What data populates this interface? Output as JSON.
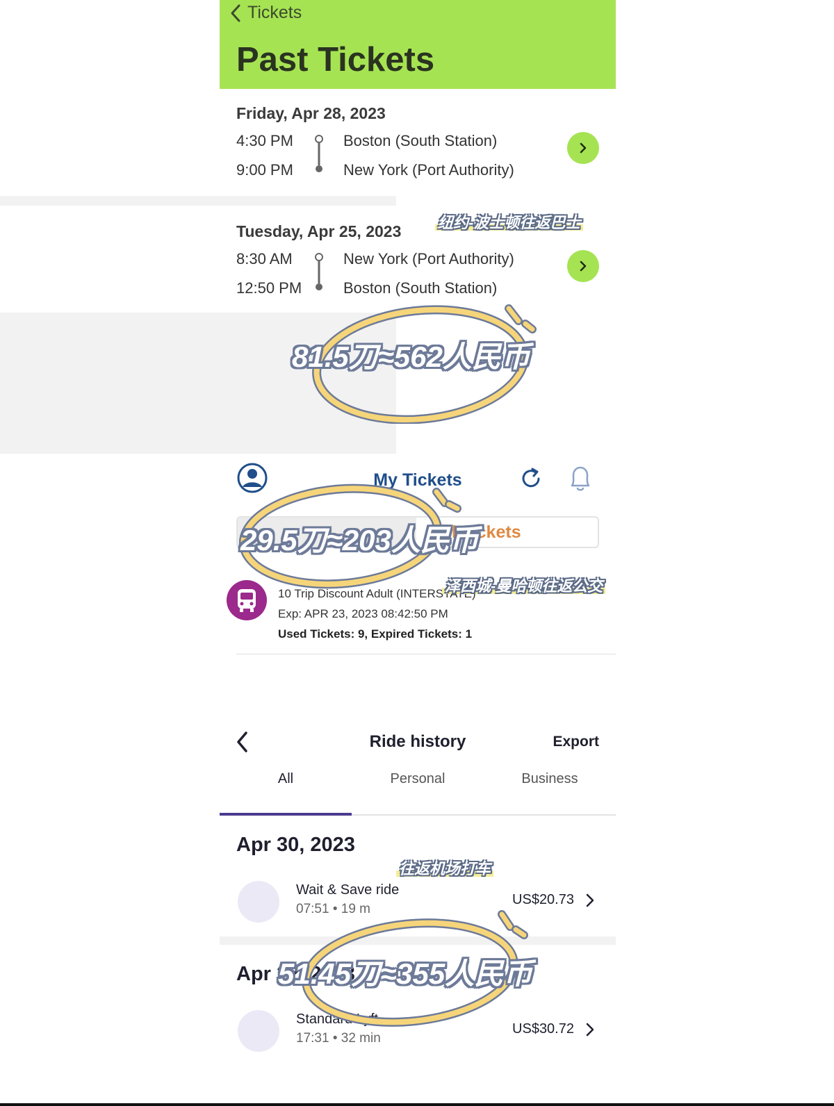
{
  "past_tickets": {
    "back_label": "Tickets",
    "title": "Past Tickets",
    "trips": [
      {
        "date": "Friday, Apr 28, 2023",
        "depart_time": "4:30 PM",
        "arrive_time": "9:00 PM",
        "origin": "Boston (South Station)",
        "destination": "New York (Port Authority)"
      },
      {
        "date": "Tuesday, Apr 25, 2023",
        "depart_time": "8:30 AM",
        "arrive_time": "12:50 PM",
        "origin": "New York (Port Authority)",
        "destination": "Boston (South Station)"
      }
    ]
  },
  "my_tickets": {
    "title": "My Tickets",
    "tab_all": "All Tickets",
    "ticket": {
      "product": "10 Trip Discount Adult (INTERSTATE)",
      "expiry": "Exp: APR 23, 2023 08:42:50 PM",
      "usage": "Used Tickets: 9, Expired Tickets: 1"
    }
  },
  "ride_history": {
    "title": "Ride history",
    "export_label": "Export",
    "tabs": [
      "All",
      "Personal",
      "Business"
    ],
    "active_tab": "All",
    "groups": [
      {
        "date": "Apr 30, 2023",
        "rides": [
          {
            "name": "Wait & Save ride",
            "meta": "07:51 • 19 m",
            "price": "US$20.73"
          }
        ]
      },
      {
        "date": "Apr 22, 2023",
        "rides": [
          {
            "name": "Standard Lyft",
            "meta": "17:31 • 32 min",
            "price": "US$30.72"
          }
        ]
      }
    ]
  },
  "annotations": {
    "caption_bus": "纽约-波士顿往返巴士",
    "price_bus": "81.5刀≈562人民币",
    "caption_transit": "泽西城-曼哈顿往返公交",
    "price_transit": "29.5刀≈203人民币",
    "caption_ride": "往返机场打车",
    "price_ride": "51.45刀≈355人民币"
  },
  "colors": {
    "brand_green": "#a6e353",
    "nj_blue": "#1f4e8a",
    "nj_orange": "#e08840",
    "bus_purple": "#9b2a8c",
    "lyft_underline": "#4b3a8f",
    "highlight_yellow": "#f6d57a"
  },
  "icons": {
    "back": "chevron-left-icon",
    "go": "chevron-right-icon",
    "profile": "user-circle-icon",
    "refresh": "refresh-icon",
    "bell": "bell-icon",
    "bus": "bus-icon"
  }
}
